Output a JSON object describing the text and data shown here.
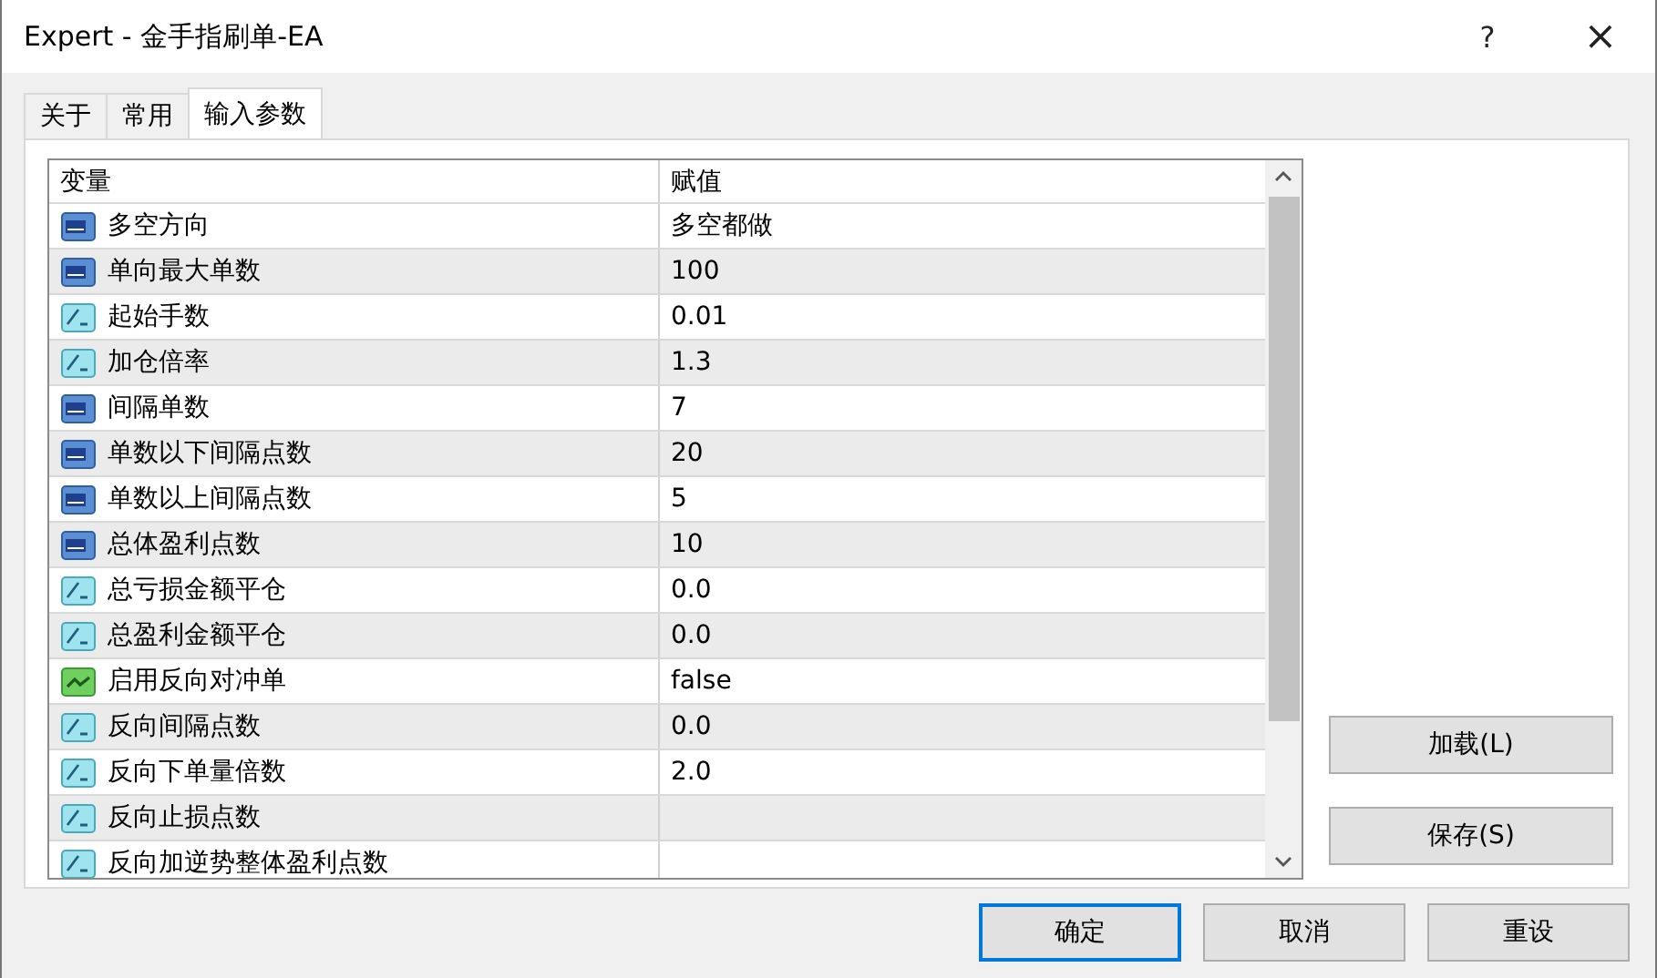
{
  "window": {
    "title": "Expert - 金手指刷单-EA",
    "help": "?",
    "close": "×"
  },
  "tabs": [
    {
      "label": "关于",
      "selected": false
    },
    {
      "label": "常用",
      "selected": false
    },
    {
      "label": "输入参数",
      "selected": true
    }
  ],
  "table": {
    "columns": [
      "变量",
      "赋值"
    ],
    "rows": [
      {
        "kind": "int",
        "name": "多空方向",
        "value": "多空都做"
      },
      {
        "kind": "int",
        "name": "单向最大单数",
        "value": "100"
      },
      {
        "kind": "double",
        "name": "起始手数",
        "value": "0.01"
      },
      {
        "kind": "double",
        "name": "加仓倍率",
        "value": "1.3"
      },
      {
        "kind": "int",
        "name": "间隔单数",
        "value": "7"
      },
      {
        "kind": "int",
        "name": "单数以下间隔点数",
        "value": "20"
      },
      {
        "kind": "int",
        "name": "单数以上间隔点数",
        "value": "5"
      },
      {
        "kind": "int",
        "name": "总体盈利点数",
        "value": "10"
      },
      {
        "kind": "double",
        "name": "总亏损金额平仓",
        "value": "0.0"
      },
      {
        "kind": "double",
        "name": "总盈利金额平仓",
        "value": "0.0"
      },
      {
        "kind": "bool",
        "name": "启用反向对冲单",
        "value": "false"
      },
      {
        "kind": "double",
        "name": "反向间隔点数",
        "value": "0.0"
      },
      {
        "kind": "double",
        "name": "反向下单量倍数",
        "value": "2.0"
      },
      {
        "kind": "double",
        "name": "反向止损点数"
      },
      {
        "kind": "double",
        "name": "反向加逆势整体盈利点数"
      }
    ]
  },
  "side_buttons": [
    "加载(L)",
    "保存(S)"
  ],
  "bottom_buttons": [
    {
      "label": "确定",
      "default": true
    },
    {
      "label": "取消",
      "default": false
    },
    {
      "label": "重设",
      "default": false
    }
  ]
}
